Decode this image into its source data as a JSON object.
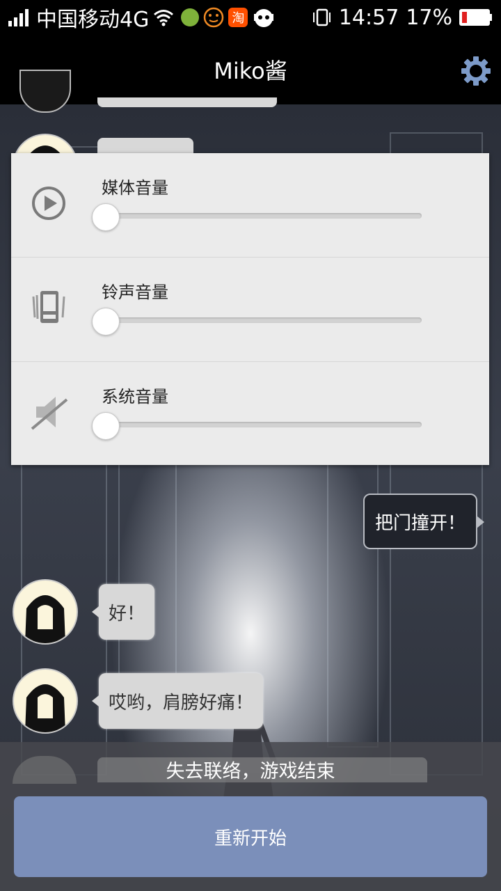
{
  "status_bar": {
    "carrier": "中国移动4G",
    "time": "14:57",
    "battery": "17%",
    "notification_icons": [
      "app-icon",
      "smiley-icon",
      "taobao-icon",
      "cartoon-face-icon"
    ],
    "taobao_label": "淘"
  },
  "header": {
    "title": "Miko酱"
  },
  "chat": {
    "messages": [
      {
        "side": "right",
        "text": "把门撞开！"
      },
      {
        "side": "left",
        "text": "好！"
      },
      {
        "side": "left",
        "text": "哎哟，肩膀好痛！"
      }
    ]
  },
  "volume_panel": {
    "rows": [
      {
        "label": "媒体音量",
        "icon": "play-icon",
        "level": 0
      },
      {
        "label": "铃声音量",
        "icon": "vibrate-phone-icon",
        "level": 0
      },
      {
        "label": "系统音量",
        "icon": "speaker-muted-icon",
        "level": 0
      }
    ]
  },
  "game_over": {
    "message": "失去联络，游戏结束",
    "restart_label": "重新开始"
  },
  "colors": {
    "restart_button": "#7b8fba",
    "panel_bg": "#ebebeb",
    "battery_low": "#e02020"
  }
}
